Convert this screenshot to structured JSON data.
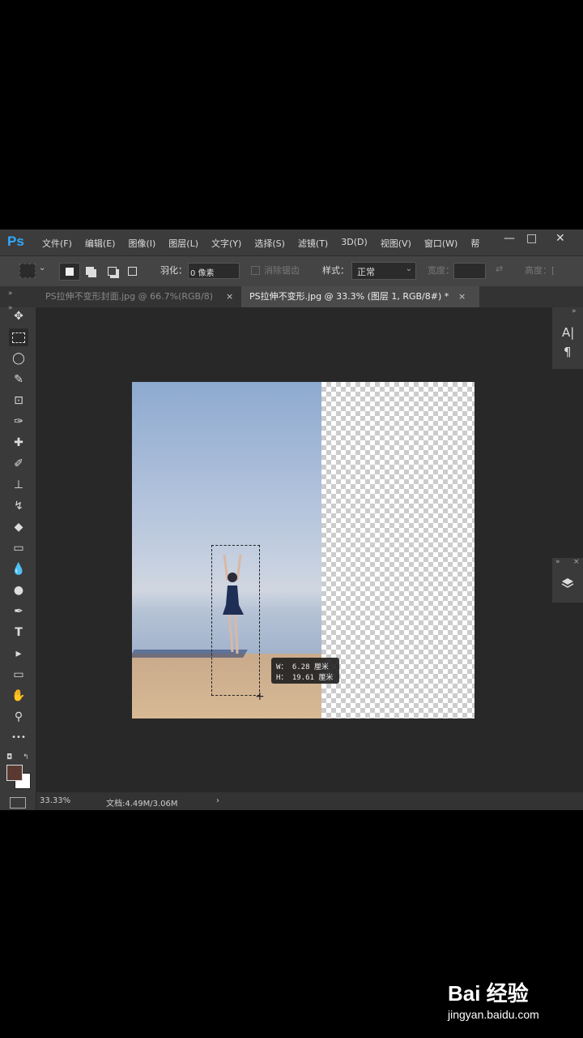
{
  "app": {
    "logo": "Ps"
  },
  "menu": [
    "文件(F)",
    "编辑(E)",
    "图像(I)",
    "图层(L)",
    "文字(Y)",
    "选择(S)",
    "滤镜(T)",
    "3D(D)",
    "视图(V)",
    "窗口(W)",
    "帮"
  ],
  "window_controls": {
    "minimize": "—",
    "maximize": "□",
    "close": "✕"
  },
  "options": {
    "feather_label": "羽化：",
    "feather_value": "0 像素",
    "antialias_label": "消除锯齿",
    "style_label": "样式：",
    "style_value": "正常",
    "width_label": "宽度：",
    "height_label": "高度：["
  },
  "tabs": [
    {
      "label": "PS拉伸不变形封面.jpg @ 66.7%(RGB/8)",
      "close": "×",
      "active": false
    },
    {
      "label": "PS拉伸不变形.jpg @ 33.3% (图层 1, RGB/8#) *",
      "close": "×",
      "active": true
    }
  ],
  "tools": [
    "✥",
    "⬚",
    "◯",
    "✎",
    "⊡",
    "✑",
    "✚",
    "✐",
    "⊥",
    "↯",
    "◆",
    "▭",
    "💧",
    "●",
    "✒",
    "T",
    "▸",
    "▭",
    "✋",
    "⚲",
    "•••"
  ],
  "readout": {
    "w_label": "W：",
    "w_value": "6.28 厘米",
    "h_label": "H：",
    "h_value": "19.61 厘米"
  },
  "status": {
    "zoom": "33.33%",
    "doc": "文档:4.49M/3.06M",
    "arrow": "›"
  },
  "right_panel": {
    "char_icon": "A|",
    "para_icon": "¶",
    "collapse": "»",
    "close": "×"
  },
  "watermark": {
    "brand": "Bai 经验",
    "url": "jingyan.baidu.com"
  },
  "colors": {
    "foreground": "#5a3a30",
    "background": "#ffffff",
    "accent": "#31a8ff"
  }
}
